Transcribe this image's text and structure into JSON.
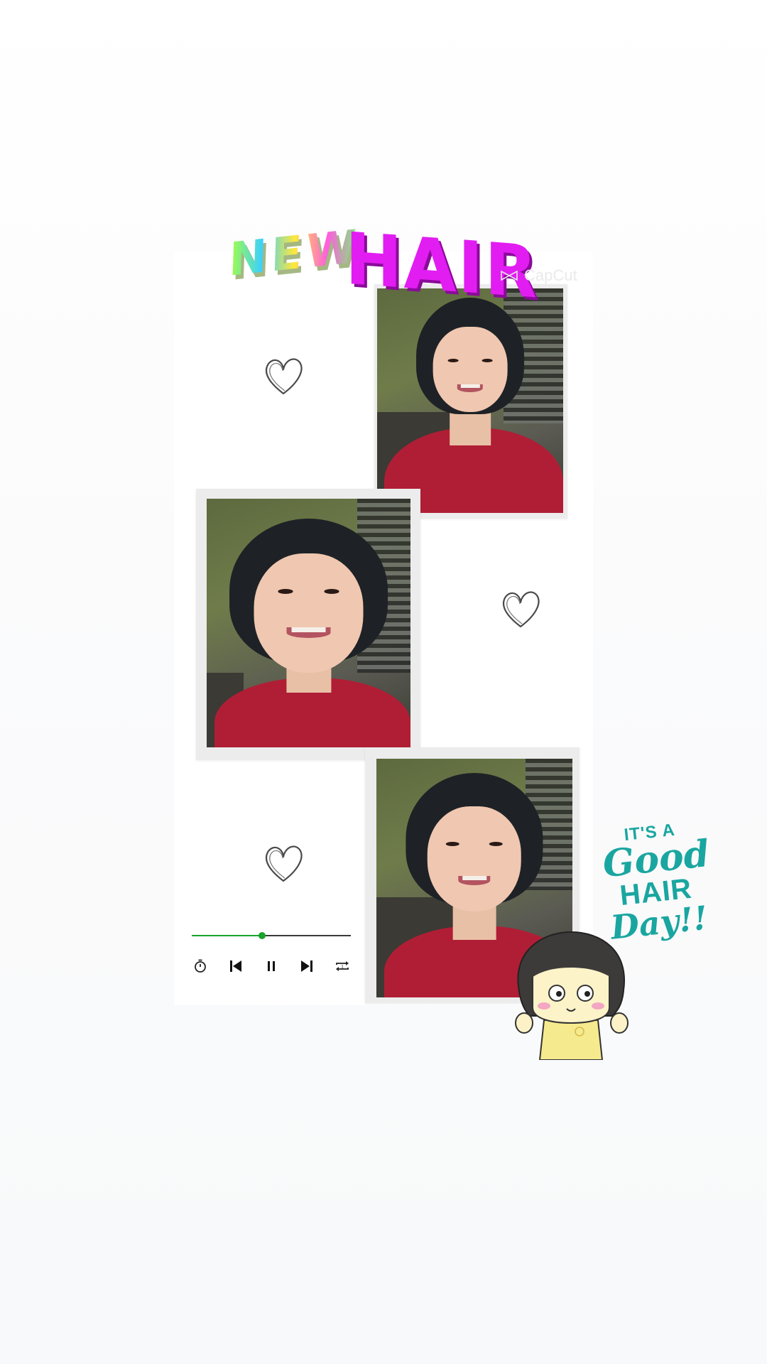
{
  "stickers": {
    "title_new": "NEW",
    "title_hair": "HAIR",
    "watermark": "CapCut",
    "good_hair_line1": "IT'S A",
    "good_hair_line2": "Good",
    "good_hair_line3": "HAIR",
    "good_hair_line4": "Day!!"
  },
  "player": {
    "progress": 0.44,
    "accent_color": "#1aa32b",
    "controls": [
      "timer-icon",
      "previous-icon",
      "pause-icon",
      "next-icon",
      "repeat-icon"
    ]
  },
  "colors": {
    "hair_title": "#e21df2",
    "good_hair": "#1aa6a0",
    "shirt": "#b01e35"
  }
}
